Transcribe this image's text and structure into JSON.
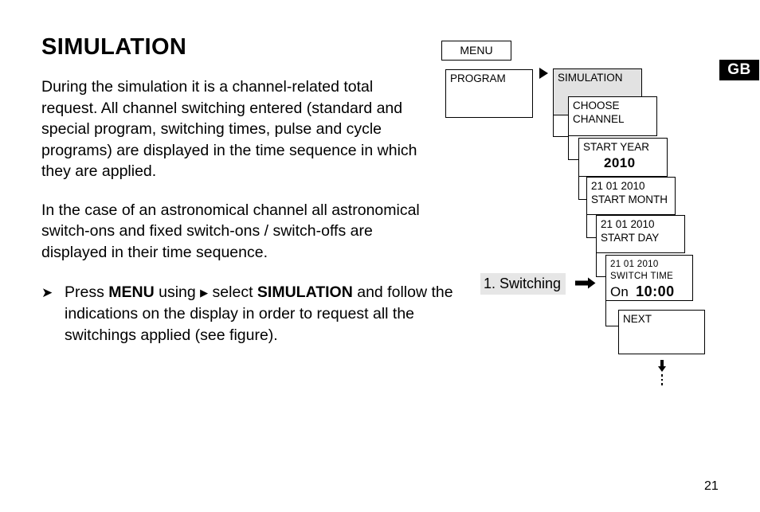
{
  "document": {
    "title": "SIMULATION",
    "page_number": "21",
    "language_badge": "GB"
  },
  "body": {
    "paragraphs": [
      "During the simulation it is a channel-related total request. All channel switching entered (standard and special program, switching times, pulse and cycle programs) are displayed in the time sequence in which they are applied.",
      "In the case of an astronomical channel all astronomical switch-ons and fixed switch-ons / switch-offs are displayed in their time sequence."
    ],
    "instruction": {
      "bullet_icon": "➤",
      "segment_1": "Press ",
      "bold_1": "MENU",
      "segment_2": " using ",
      "inline_triangle": "▶",
      "segment_3": " select ",
      "bold_2": "SIMULATION",
      "segment_4": " and follow the indications on the display in order to request all the switchings applied (see figure)."
    }
  },
  "diagram": {
    "switching_label": "1. Switching",
    "boxes": {
      "menu": {
        "label": "MENU"
      },
      "program": {
        "label": "PROGRAM"
      },
      "simulation": {
        "label": "SIMULATION",
        "shaded_color": "#e2e2e2"
      },
      "choose_channel": {
        "line1": "CHOOSE",
        "line2": "CHANNEL"
      },
      "start_year": {
        "label": "START YEAR",
        "value": "2010"
      },
      "start_month": {
        "date": "21  01  2010",
        "label": "START MONTH"
      },
      "start_day": {
        "date": "21  01  2010",
        "label": "START DAY"
      },
      "switch_time": {
        "date": "21  01  2010",
        "label": "SWITCH TIME",
        "state": "On",
        "time": "10:00"
      },
      "next": {
        "label": "NEXT"
      }
    }
  }
}
